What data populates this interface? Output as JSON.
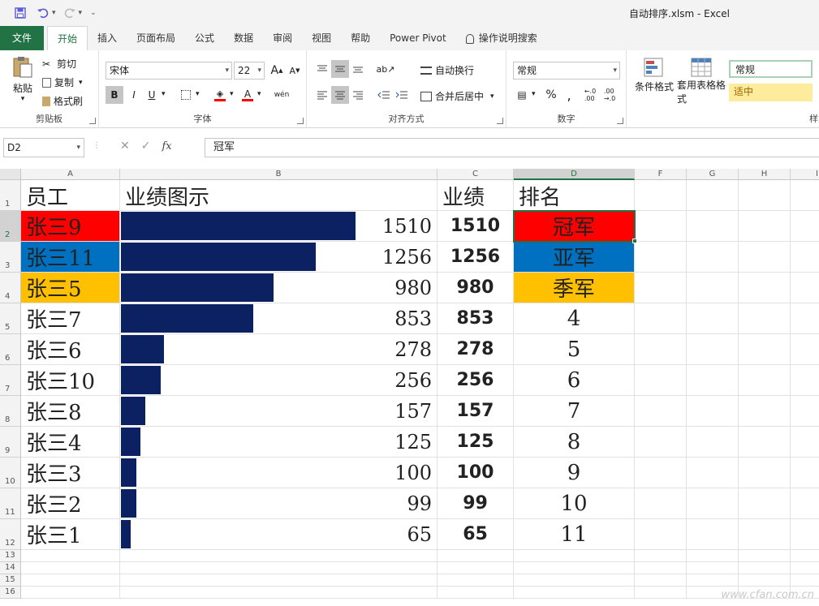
{
  "window": {
    "title": "自动排序.xlsm  -  Excel"
  },
  "tabs": [
    "文件",
    "开始",
    "插入",
    "页面布局",
    "公式",
    "数据",
    "审阅",
    "视图",
    "帮助",
    "Power Pivot",
    "操作说明搜索"
  ],
  "ribbon": {
    "clipboard": {
      "paste": "粘贴",
      "cut": "剪切",
      "copy": "复制",
      "format_painter": "格式刷",
      "label": "剪贴板"
    },
    "font": {
      "name": "宋体",
      "size": "22",
      "bold": "B",
      "italic": "I",
      "underline": "U",
      "phonetic": "wén",
      "grow": "A",
      "shrink": "A",
      "font_color": "A",
      "label": "字体"
    },
    "alignment": {
      "wrap": "自动换行",
      "merge": "合并后居中",
      "label": "对齐方式"
    },
    "number": {
      "format": "常规",
      "percent": "%",
      "comma": ",",
      "label": "数字"
    },
    "styles": {
      "conditional": "条件格式",
      "table_format": "套用表格格式",
      "normal": "常规",
      "neutral": "适中",
      "label": "样式"
    }
  },
  "formula_bar": {
    "name_box": "D2",
    "fx": "fx",
    "content": "冠军"
  },
  "columns": [
    "A",
    "B",
    "C",
    "D",
    "F",
    "G",
    "H",
    "I"
  ],
  "rows": [
    "1",
    "2",
    "3",
    "4",
    "5",
    "6",
    "7",
    "8",
    "9",
    "10",
    "11",
    "12",
    "13",
    "14",
    "15",
    "16"
  ],
  "header": {
    "employee": "员工",
    "chart": "业绩图示",
    "performance": "业绩",
    "rank": "排名"
  },
  "records": [
    {
      "name": "张三9",
      "value": "1510",
      "perf": "1510",
      "rank": "冠军"
    },
    {
      "name": "张三11",
      "value": "1256",
      "perf": "1256",
      "rank": "亚军"
    },
    {
      "name": "张三5",
      "value": "980",
      "perf": "980",
      "rank": "季军"
    },
    {
      "name": "张三7",
      "value": "853",
      "perf": "853",
      "rank": "4"
    },
    {
      "name": "张三6",
      "value": "278",
      "perf": "278",
      "rank": "5"
    },
    {
      "name": "张三10",
      "value": "256",
      "perf": "256",
      "rank": "6"
    },
    {
      "name": "张三8",
      "value": "157",
      "perf": "157",
      "rank": "7"
    },
    {
      "name": "张三4",
      "value": "125",
      "perf": "125",
      "rank": "8"
    },
    {
      "name": "张三3",
      "value": "100",
      "perf": "100",
      "rank": "9"
    },
    {
      "name": "张三2",
      "value": "99",
      "perf": "99",
      "rank": "10"
    },
    {
      "name": "张三1",
      "value": "65",
      "perf": "65",
      "rank": "11"
    }
  ],
  "colors": {
    "accent": "#217346",
    "gold": "#ff0000",
    "silver": "#0070c0",
    "bronze": "#ffc000",
    "bar": "#0c2161",
    "neutral_style": "#ffeb9c"
  },
  "watermark": "www.cfan.com.cn"
}
